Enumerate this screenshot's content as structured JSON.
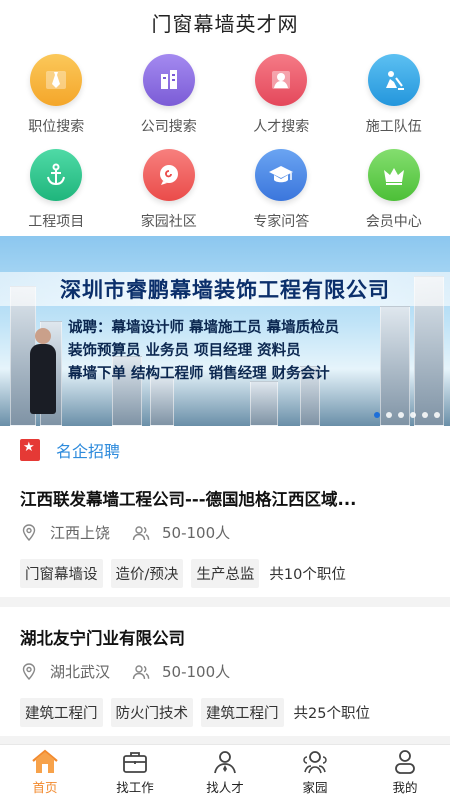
{
  "header": {
    "title": "门窗幕墙英才网"
  },
  "grid": [
    {
      "label": "职位搜索",
      "icon": "tie-icon",
      "color": "#f7b336"
    },
    {
      "label": "公司搜索",
      "icon": "building-icon",
      "color": "#8d6fe0"
    },
    {
      "label": "人才搜索",
      "icon": "person-card-icon",
      "color": "#ee5a6b"
    },
    {
      "label": "施工队伍",
      "icon": "worker-icon",
      "color": "#35a8e8"
    },
    {
      "label": "工程项目",
      "icon": "anchor-icon",
      "color": "#2dc98f"
    },
    {
      "label": "家园社区",
      "icon": "chat-icon",
      "color": "#f2615f"
    },
    {
      "label": "专家问答",
      "icon": "graduation-cap-icon",
      "color": "#4a88e8"
    },
    {
      "label": "会员中心",
      "icon": "crown-icon",
      "color": "#63cf4f"
    }
  ],
  "banner": {
    "company": "深圳市睿鹏幕墙装饰工程有限公司",
    "lines": [
      "诚聘：幕墙设计师  幕墙施工员  幕墙质检员",
      "装饰预算员  业务员  项目经理  资料员",
      "幕墙下单  结构工程师  销售经理  财务会计"
    ],
    "slide_count": 6,
    "active_slide": 1
  },
  "section": {
    "title": "名企招聘"
  },
  "cards": [
    {
      "name": "江西联发幕墙工程公司---德国旭格江西区域...",
      "location": "江西上饶",
      "size": "50-100人",
      "tags": [
        "门窗幕墙设",
        "造价/预决",
        "生产总监"
      ],
      "count": "共10个职位"
    },
    {
      "name": "湖北友宁门业有限公司",
      "location": "湖北武汉",
      "size": "50-100人",
      "tags": [
        "建筑工程门",
        "防火门技术",
        "建筑工程门"
      ],
      "count": "共25个职位"
    }
  ],
  "tabbar": [
    {
      "label": "首页",
      "icon": "home-icon",
      "active": true
    },
    {
      "label": "找工作",
      "icon": "briefcase-icon",
      "active": false
    },
    {
      "label": "找人才",
      "icon": "user-icon",
      "active": false
    },
    {
      "label": "家园",
      "icon": "community-icon",
      "active": false
    },
    {
      "label": "我的",
      "icon": "profile-icon",
      "active": false
    }
  ],
  "colors": {
    "accent_blue": "#2e8bdc",
    "active_tab": "#f28a2e",
    "section_badge": "#e53935"
  }
}
